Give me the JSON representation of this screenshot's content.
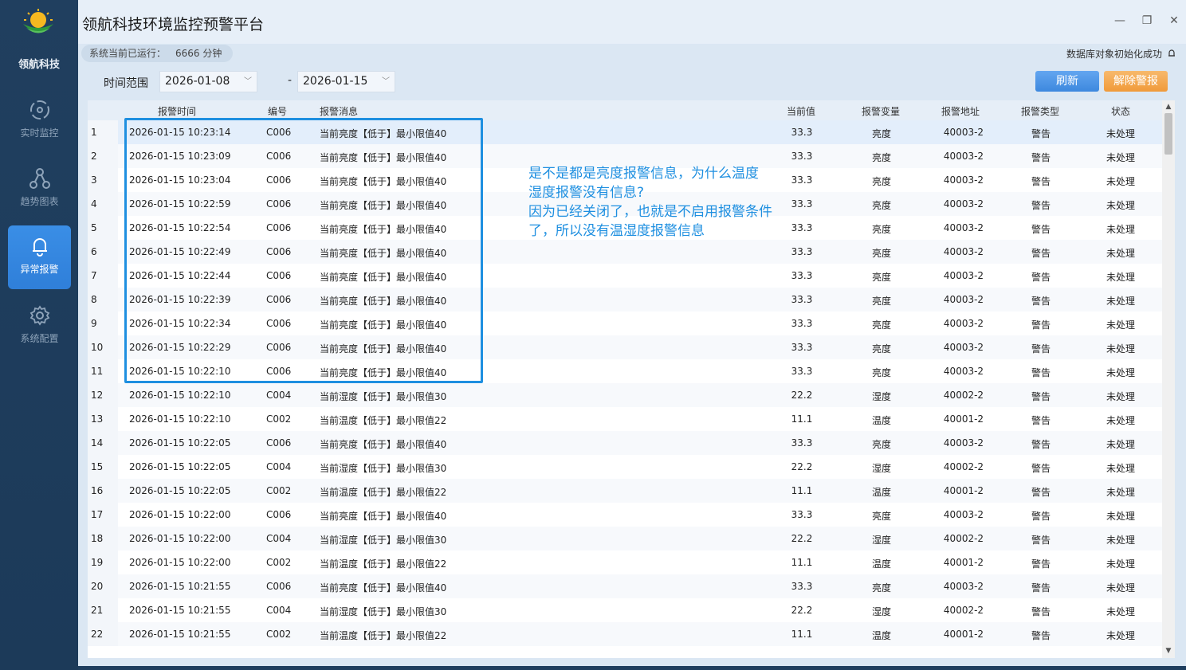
{
  "sidebar": {
    "brand": "领航科技",
    "items": [
      {
        "label": "实时监控",
        "icon": "monitor-icon",
        "active": false
      },
      {
        "label": "趋势图表",
        "icon": "network-icon",
        "active": false
      },
      {
        "label": "异常报警",
        "icon": "bell-icon",
        "active": true
      },
      {
        "label": "系统配置",
        "icon": "gear-icon",
        "active": false
      }
    ]
  },
  "window": {
    "title": "领航科技环境监控预警平台",
    "runtime_label": "系统当前已运行：",
    "runtime_value": "6666 分钟",
    "db_status": "数据库对象初始化成功"
  },
  "filter": {
    "label": "时间范围",
    "start_date": "2026-01-08",
    "end_date": "2026-01-15",
    "separator": "-"
  },
  "buttons": {
    "refresh": "刷新",
    "clear_alarm": "解除警报"
  },
  "table": {
    "headers": [
      "报警时间",
      "编号",
      "报警消息",
      "当前值",
      "报警变量",
      "报警地址",
      "报警类型",
      "状态"
    ],
    "rows": [
      [
        "1",
        "2026-01-15 10:23:14",
        "C006",
        "当前亮度【低于】最小限值40",
        "33.3",
        "亮度",
        "40003-2",
        "警告",
        "未处理"
      ],
      [
        "2",
        "2026-01-15 10:23:09",
        "C006",
        "当前亮度【低于】最小限值40",
        "33.3",
        "亮度",
        "40003-2",
        "警告",
        "未处理"
      ],
      [
        "3",
        "2026-01-15 10:23:04",
        "C006",
        "当前亮度【低于】最小限值40",
        "33.3",
        "亮度",
        "40003-2",
        "警告",
        "未处理"
      ],
      [
        "4",
        "2026-01-15 10:22:59",
        "C006",
        "当前亮度【低于】最小限值40",
        "33.3",
        "亮度",
        "40003-2",
        "警告",
        "未处理"
      ],
      [
        "5",
        "2026-01-15 10:22:54",
        "C006",
        "当前亮度【低于】最小限值40",
        "33.3",
        "亮度",
        "40003-2",
        "警告",
        "未处理"
      ],
      [
        "6",
        "2026-01-15 10:22:49",
        "C006",
        "当前亮度【低于】最小限值40",
        "33.3",
        "亮度",
        "40003-2",
        "警告",
        "未处理"
      ],
      [
        "7",
        "2026-01-15 10:22:44",
        "C006",
        "当前亮度【低于】最小限值40",
        "33.3",
        "亮度",
        "40003-2",
        "警告",
        "未处理"
      ],
      [
        "8",
        "2026-01-15 10:22:39",
        "C006",
        "当前亮度【低于】最小限值40",
        "33.3",
        "亮度",
        "40003-2",
        "警告",
        "未处理"
      ],
      [
        "9",
        "2026-01-15 10:22:34",
        "C006",
        "当前亮度【低于】最小限值40",
        "33.3",
        "亮度",
        "40003-2",
        "警告",
        "未处理"
      ],
      [
        "10",
        "2026-01-15 10:22:29",
        "C006",
        "当前亮度【低于】最小限值40",
        "33.3",
        "亮度",
        "40003-2",
        "警告",
        "未处理"
      ],
      [
        "11",
        "2026-01-15 10:22:10",
        "C006",
        "当前亮度【低于】最小限值40",
        "33.3",
        "亮度",
        "40003-2",
        "警告",
        "未处理"
      ],
      [
        "12",
        "2026-01-15 10:22:10",
        "C004",
        "当前湿度【低于】最小限值30",
        "22.2",
        "湿度",
        "40002-2",
        "警告",
        "未处理"
      ],
      [
        "13",
        "2026-01-15 10:22:10",
        "C002",
        "当前温度【低于】最小限值22",
        "11.1",
        "温度",
        "40001-2",
        "警告",
        "未处理"
      ],
      [
        "14",
        "2026-01-15 10:22:05",
        "C006",
        "当前亮度【低于】最小限值40",
        "33.3",
        "亮度",
        "40003-2",
        "警告",
        "未处理"
      ],
      [
        "15",
        "2026-01-15 10:22:05",
        "C004",
        "当前湿度【低于】最小限值30",
        "22.2",
        "湿度",
        "40002-2",
        "警告",
        "未处理"
      ],
      [
        "16",
        "2026-01-15 10:22:05",
        "C002",
        "当前温度【低于】最小限值22",
        "11.1",
        "温度",
        "40001-2",
        "警告",
        "未处理"
      ],
      [
        "17",
        "2026-01-15 10:22:00",
        "C006",
        "当前亮度【低于】最小限值40",
        "33.3",
        "亮度",
        "40003-2",
        "警告",
        "未处理"
      ],
      [
        "18",
        "2026-01-15 10:22:00",
        "C004",
        "当前湿度【低于】最小限值30",
        "22.2",
        "湿度",
        "40002-2",
        "警告",
        "未处理"
      ],
      [
        "19",
        "2026-01-15 10:22:00",
        "C002",
        "当前温度【低于】最小限值22",
        "11.1",
        "温度",
        "40001-2",
        "警告",
        "未处理"
      ],
      [
        "20",
        "2026-01-15 10:21:55",
        "C006",
        "当前亮度【低于】最小限值40",
        "33.3",
        "亮度",
        "40003-2",
        "警告",
        "未处理"
      ],
      [
        "21",
        "2026-01-15 10:21:55",
        "C004",
        "当前湿度【低于】最小限值30",
        "22.2",
        "湿度",
        "40002-2",
        "警告",
        "未处理"
      ],
      [
        "22",
        "2026-01-15 10:21:55",
        "C002",
        "当前温度【低于】最小限值22",
        "11.1",
        "温度",
        "40001-2",
        "警告",
        "未处理"
      ]
    ]
  },
  "annotation": {
    "lines": [
      "是不是都是亮度报警信息，为什么温度",
      "湿度报警没有信息?",
      "因为已经关闭了，也就是不启用报警条件",
      "了，所以没有温湿度报警信息"
    ]
  },
  "colors": {
    "sidebar_bg": "#1f3e5e",
    "accent_blue": "#3a8ee6",
    "refresh_button": "#4a94e4",
    "clear_button": "#f2a548",
    "annotation": "#1e8fe0"
  }
}
